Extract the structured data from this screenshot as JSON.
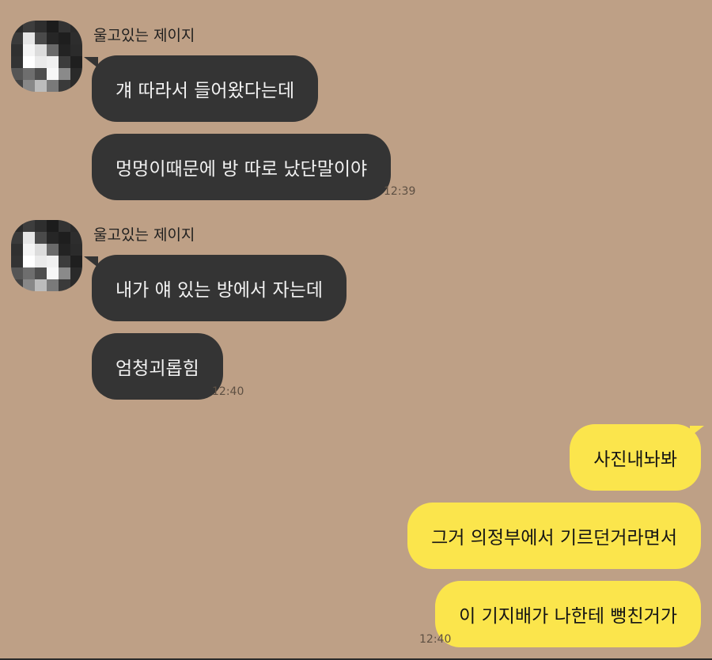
{
  "chat": {
    "groups": [
      {
        "sender": "울고있는 제이지",
        "messages": [
          "걔 따라서 들어왔다는데",
          "멍멍이때문에 방 따로 났단말이야"
        ],
        "time": "12:39"
      },
      {
        "sender": "울고있는 제이지",
        "messages": [
          "내가 얘 있는 방에서 자는데",
          "엄청괴롭힘"
        ],
        "time": "12:40"
      }
    ],
    "outgoing": {
      "messages": [
        "사진내놔봐",
        "그거 의정부에서 기르던거라면서",
        "이 기지배가 나한테 뻥친거가"
      ],
      "time": "12:40"
    }
  },
  "colors": {
    "background": "#bea086",
    "incoming_bubble": "#343434",
    "outgoing_bubble": "#fbe54c"
  }
}
